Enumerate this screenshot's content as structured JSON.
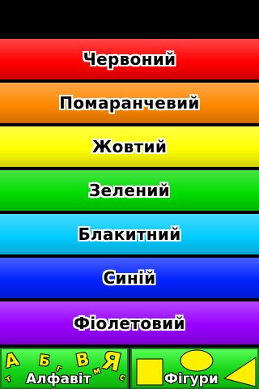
{
  "colors": [
    {
      "label": "Червоний",
      "color": "#ff0000"
    },
    {
      "label": "Помаранчевий",
      "color": "#ff8800"
    },
    {
      "label": "Жовтий",
      "color": "#ffff00"
    },
    {
      "label": "Зелений",
      "color": "#00dd00"
    },
    {
      "label": "Блакитний",
      "color": "#00ccff"
    },
    {
      "label": "Синій",
      "color": "#0022ff"
    },
    {
      "label": "Фіолетовий",
      "color": "#9900ff"
    }
  ],
  "bottom_nav": {
    "alphabet": {
      "label": "Алфавіт",
      "letters": [
        "А",
        "Б",
        "В",
        "Я",
        "г",
        "м",
        "т",
        "с"
      ]
    },
    "shapes": {
      "label": "Фігури",
      "icons": [
        "square-icon",
        "circle-icon",
        "triangle-icon"
      ]
    },
    "accent": "#ffea00"
  }
}
